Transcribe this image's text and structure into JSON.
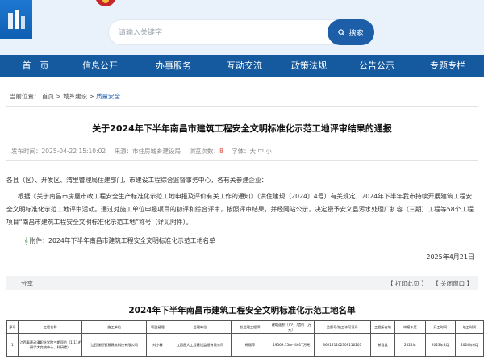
{
  "header": {
    "search_placeholder": "请输入关键字",
    "search_button": "搜索"
  },
  "nav": [
    "首　页",
    "信息公开",
    "办事服务",
    "互动交流",
    "政策法规",
    "公告公示",
    "专题专栏"
  ],
  "breadcrumb": {
    "prefix": "当前位置：",
    "home": "首页",
    "sep": ">",
    "level1": "城乡建设",
    "level2": "质量安全"
  },
  "article": {
    "title": "关于2024年下半年南昌市建筑工程安全文明标准化示范工地评审结果的通报",
    "meta_date": "发布时间：2025-04-22 15:10:02",
    "meta_source": "来源：市住房城乡建设局",
    "meta_views_label": "浏览次数：",
    "meta_views": "8",
    "meta_font": "字体：大 中 小",
    "salutation": "各县（区）、开发区、湾里管理局住建部门，市建设工程综合监督事务中心，各有关参建企业：",
    "body": "根据《关于南昌市房屋市政工程安全生产标准化示范工地申报及评价有关工作的通知》（洪住建规〔2024〕4号）有关规定，2024年下半年我市持续开展建筑工程安全文明标准化示范工地评审活动。通过对施工单位申报项目的初评和综合评审，按照评审结果，并经网站公示，决定授予安义县污水处理厂扩容（三期）工程等58个工程项目“南昌市建筑工程安全文明标准化示范工地”称号（详见附件）。",
    "attachment": "附件：2024年下半年南昌市建筑工程安全文明标准化示范工地名单",
    "date": "2025年4月21日"
  },
  "share_bar": {
    "share": "分享",
    "print": "【 打印此页 】",
    "close": "【 关闭窗口 】"
  },
  "document": {
    "title": "2024年下半年南昌市建筑工程安全文明标准化示范工地名单",
    "columns": [
      "序号",
      "工程名称",
      "施工单位",
      "项目经理",
      "监理单位",
      "总监理工程师",
      "建筑面积（m²）/造价（万元）",
      "监督号/施工许可证号",
      "工程所在地",
      "申报年度",
      "开工时间",
      "竣工时间"
    ],
    "rows": [
      [
        "1",
        "江西泰豪动漫职业学院三期项目（1-11#研学大交流中心、科研楼）",
        "江西瑞恒智慧建筑科技有限公司",
        "刘小春",
        "江西昌大工程建设监理有限公司",
        "熊丽萍",
        "19569.15m²/4017万元",
        "360121202309110201",
        "新县县",
        "2024年",
        "2023年8月",
        "2024年6月"
      ]
    ]
  }
}
